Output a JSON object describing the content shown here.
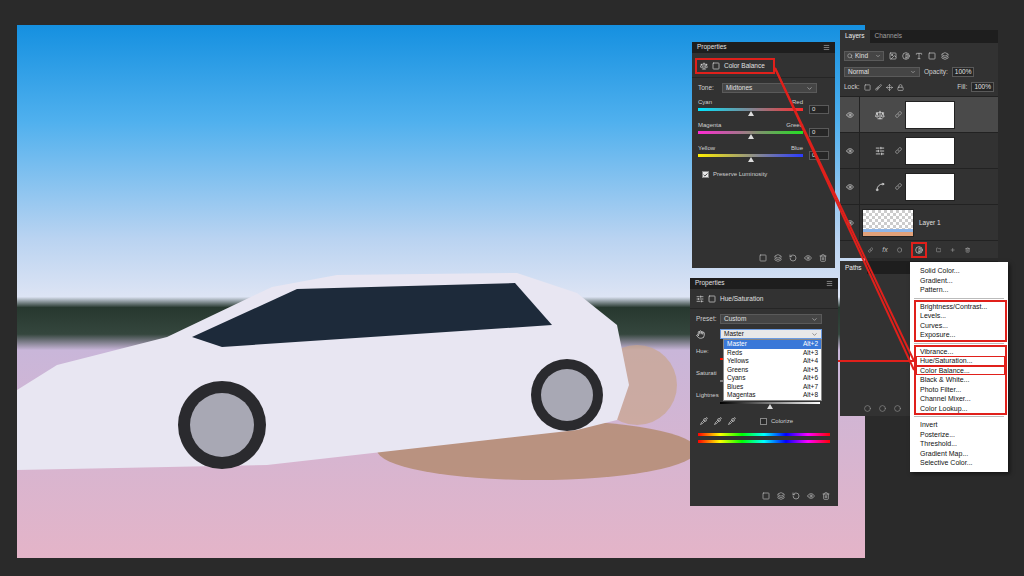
{
  "color_balance_panel": {
    "title": "Properties",
    "name": "Color Balance",
    "annotated": true,
    "tone_label": "Tone:",
    "tone": "Midtones",
    "sliders": [
      {
        "left": "Cyan",
        "right": "Red",
        "value": "0",
        "level": 0.5
      },
      {
        "left": "Magenta",
        "right": "Green",
        "value": "0",
        "level": 0.5
      },
      {
        "left": "Yellow",
        "right": "Blue",
        "value": "0",
        "level": 0.5
      }
    ],
    "preserve_luminosity": {
      "label": "Preserve Luminosity",
      "checked": true
    }
  },
  "layers_panel": {
    "tabs": [
      {
        "label": "Layers",
        "selected": true
      },
      {
        "label": "Channels",
        "selected": false
      }
    ],
    "filter": "Kind",
    "blend_mode": "Normal",
    "opacity_label": "Opacity:",
    "opacity": "100%",
    "lock_label": "Lock:",
    "fill_label": "Fill:",
    "fill": "100%",
    "layers": [
      {
        "kind": "color-balance",
        "selected": true,
        "visible": true
      },
      {
        "kind": "hue-saturation",
        "selected": false,
        "visible": true
      },
      {
        "kind": "curves",
        "selected": false,
        "visible": true
      },
      {
        "kind": "pixel",
        "name": "Layer 1",
        "selected": false,
        "visible": true
      }
    ],
    "fx_label": "fx",
    "adjustment_button_annotated": true
  },
  "paths_panel": {
    "tabs": [
      {
        "label": "Paths",
        "selected": true
      }
    ]
  },
  "adjustment_menu": {
    "sections": [
      {
        "annotated": false,
        "items": [
          {
            "label": "Solid Color...",
            "annotated": false
          },
          {
            "label": "Gradient...",
            "annotated": false
          },
          {
            "label": "Pattern...",
            "annotated": false
          }
        ]
      },
      {
        "annotated": true,
        "items": [
          {
            "label": "Brightness/Contrast...",
            "annotated": false
          },
          {
            "label": "Levels...",
            "annotated": false
          },
          {
            "label": "Curves...",
            "annotated": false
          },
          {
            "label": "Exposure...",
            "annotated": false
          }
        ]
      },
      {
        "annotated": true,
        "items": [
          {
            "label": "Vibrance...",
            "annotated": false
          },
          {
            "label": "Hue/Saturation...",
            "annotated": true
          },
          {
            "label": "Color Balance...",
            "annotated": true
          },
          {
            "label": "Black & White...",
            "annotated": false
          },
          {
            "label": "Photo Filter...",
            "annotated": false
          },
          {
            "label": "Channel Mixer...",
            "annotated": false
          },
          {
            "label": "Color Lookup...",
            "annotated": false
          }
        ]
      },
      {
        "annotated": false,
        "items": [
          {
            "label": "Invert",
            "annotated": false
          },
          {
            "label": "Posterize...",
            "annotated": false
          },
          {
            "label": "Threshold...",
            "annotated": false
          },
          {
            "label": "Gradient Map...",
            "annotated": false
          },
          {
            "label": "Selective Color...",
            "annotated": false
          }
        ]
      }
    ]
  },
  "hue_saturation_panel": {
    "title": "Properties",
    "name": "Hue/Saturation",
    "preset_label": "Preset:",
    "preset": "Custom",
    "channel": "Master",
    "channel_list_open": true,
    "channel_options": [
      {
        "label": "Master",
        "shortcut": "Alt+2",
        "selected": true
      },
      {
        "label": "Reds",
        "shortcut": "Alt+3",
        "selected": false
      },
      {
        "label": "Yellows",
        "shortcut": "Alt+4",
        "selected": false
      },
      {
        "label": "Greens",
        "shortcut": "Alt+5",
        "selected": false
      },
      {
        "label": "Cyans",
        "shortcut": "Alt+6",
        "selected": false
      },
      {
        "label": "Blues",
        "shortcut": "Alt+7",
        "selected": false
      },
      {
        "label": "Magentas",
        "shortcut": "Alt+8",
        "selected": false
      }
    ],
    "sliders": [
      {
        "label": "Hue:",
        "level": 0.5
      },
      {
        "label": "Saturati",
        "level": 0.5
      },
      {
        "label": "Lightnes",
        "level": 0.5
      }
    ],
    "colorize": {
      "label": "Colorize",
      "checked": false
    }
  }
}
